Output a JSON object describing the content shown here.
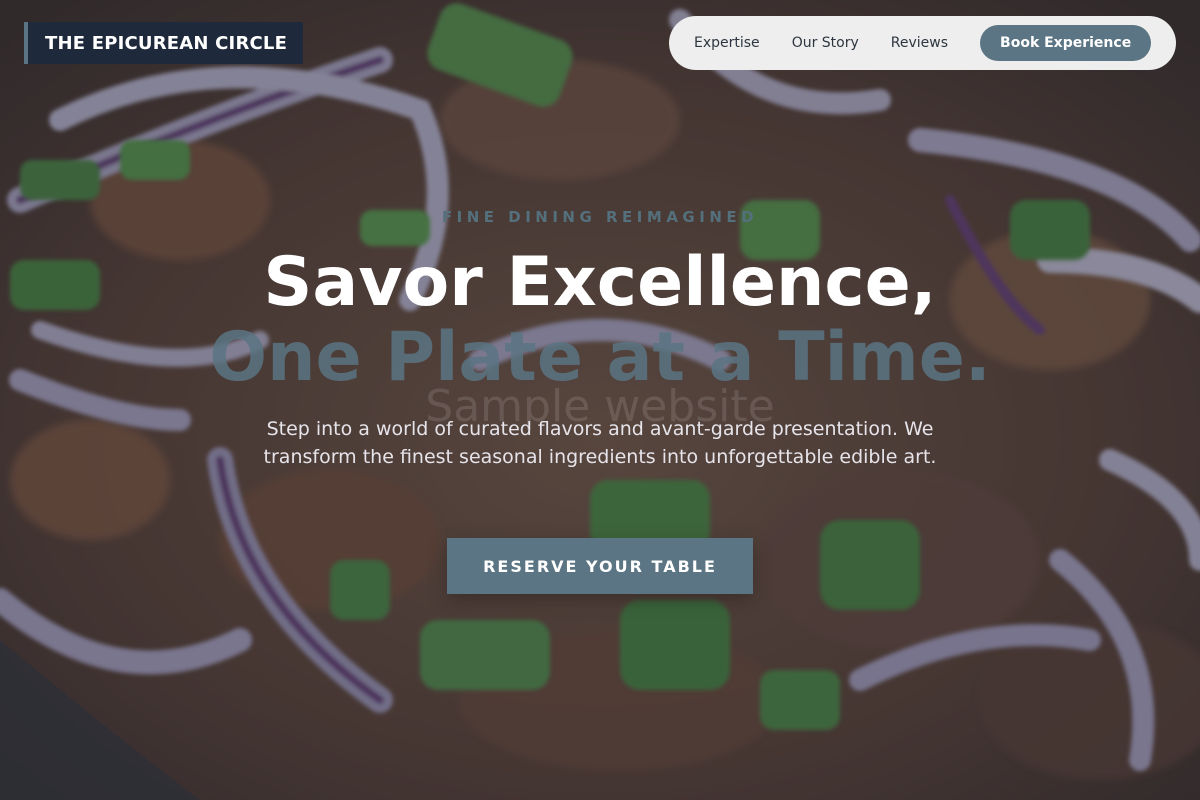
{
  "brand": {
    "name": "THE EPICUREAN CIRCLE"
  },
  "nav": {
    "links": [
      "Expertise",
      "Our Story",
      "Reviews"
    ],
    "cta_label": "Book Experience"
  },
  "hero": {
    "eyebrow": "FINE DINING REIMAGINED",
    "headline_line1": "Savor Excellence,",
    "headline_line2": "One Plate at a Time.",
    "watermark": "Sample website",
    "description": "Step into a world of curated flavors and avant-garde presentation. We transform the finest seasonal ingredients into unforgettable edible art.",
    "cta_label": "RESERVE YOUR TABLE",
    "background_image": "food-dish-onions-greens"
  },
  "colors": {
    "accent": "#5b7584",
    "logo_bg": "#1e293b",
    "nav_bg": "#eeeeee"
  }
}
